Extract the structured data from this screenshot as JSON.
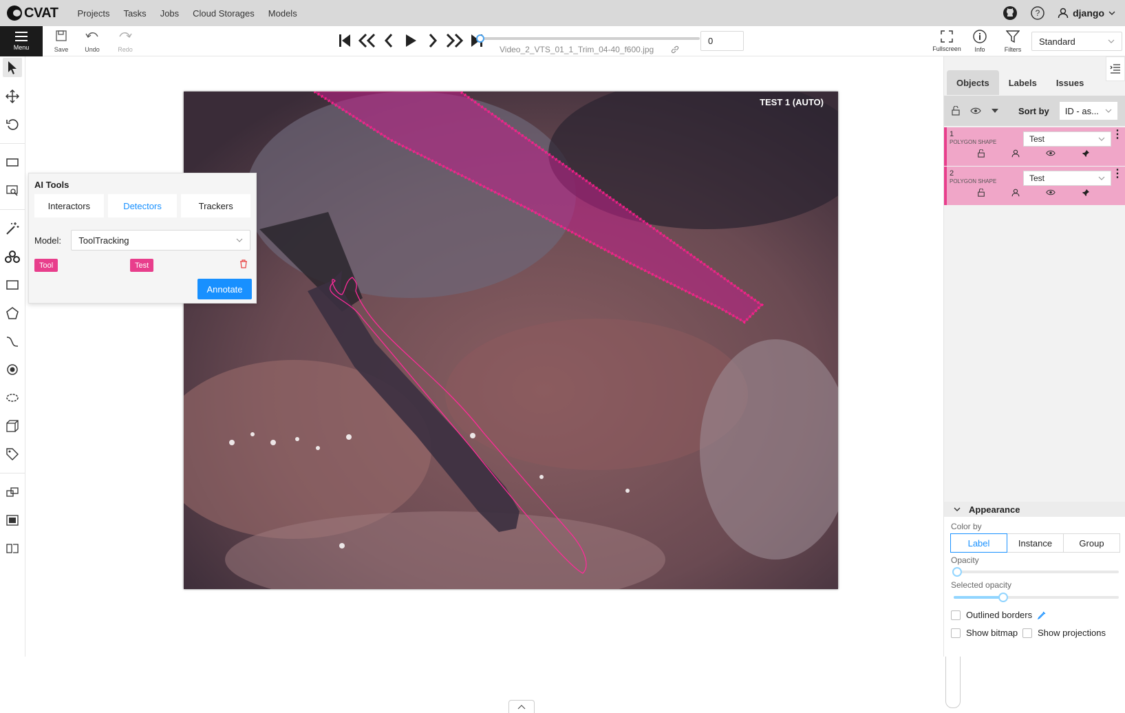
{
  "app": {
    "name": "CVAT"
  },
  "nav": {
    "items": [
      "Projects",
      "Tasks",
      "Jobs",
      "Cloud Storages",
      "Models"
    ],
    "user": "django"
  },
  "toolbar": {
    "menu_label": "Menu",
    "save_label": "Save",
    "undo_label": "Undo",
    "redo_label": "Redo",
    "frame_number": "0",
    "frame_filename": "Video_2_VTS_01_1_Trim_04-40_f600.jpg",
    "fullscreen_label": "Fullscreen",
    "info_label": "Info",
    "filters_label": "Filters",
    "workspace": "Standard"
  },
  "canvas": {
    "frame_label": "TEST 1 (AUTO)"
  },
  "ai_tools": {
    "title": "AI Tools",
    "tabs": [
      "Interactors",
      "Detectors",
      "Trackers"
    ],
    "active_tab": "Detectors",
    "model_label": "Model:",
    "model_value": "ToolTracking",
    "mapping": {
      "model_label": "Tool",
      "task_label": "Test"
    },
    "annotate_label": "Annotate"
  },
  "sidebar": {
    "tabs": [
      "Objects",
      "Labels",
      "Issues"
    ],
    "active_tab": "Objects",
    "sort_label": "Sort by",
    "sort_value": "ID - as...",
    "objects": [
      {
        "id": "1",
        "type": "POLYGON SHAPE",
        "label": "Test"
      },
      {
        "id": "2",
        "type": "POLYGON SHAPE",
        "label": "Test"
      }
    ],
    "appearance": {
      "title": "Appearance",
      "color_by_label": "Color by",
      "color_by_options": [
        "Label",
        "Instance",
        "Group"
      ],
      "color_by_active": "Label",
      "opacity_label": "Opacity",
      "opacity_value": 0,
      "selected_opacity_label": "Selected opacity",
      "selected_opacity_value": 0.3,
      "outlined_borders_label": "Outlined borders",
      "show_bitmap_label": "Show bitmap",
      "show_projections_label": "Show projections"
    }
  },
  "colors": {
    "accent": "#1890ff",
    "label_color": "#e83e8c"
  }
}
